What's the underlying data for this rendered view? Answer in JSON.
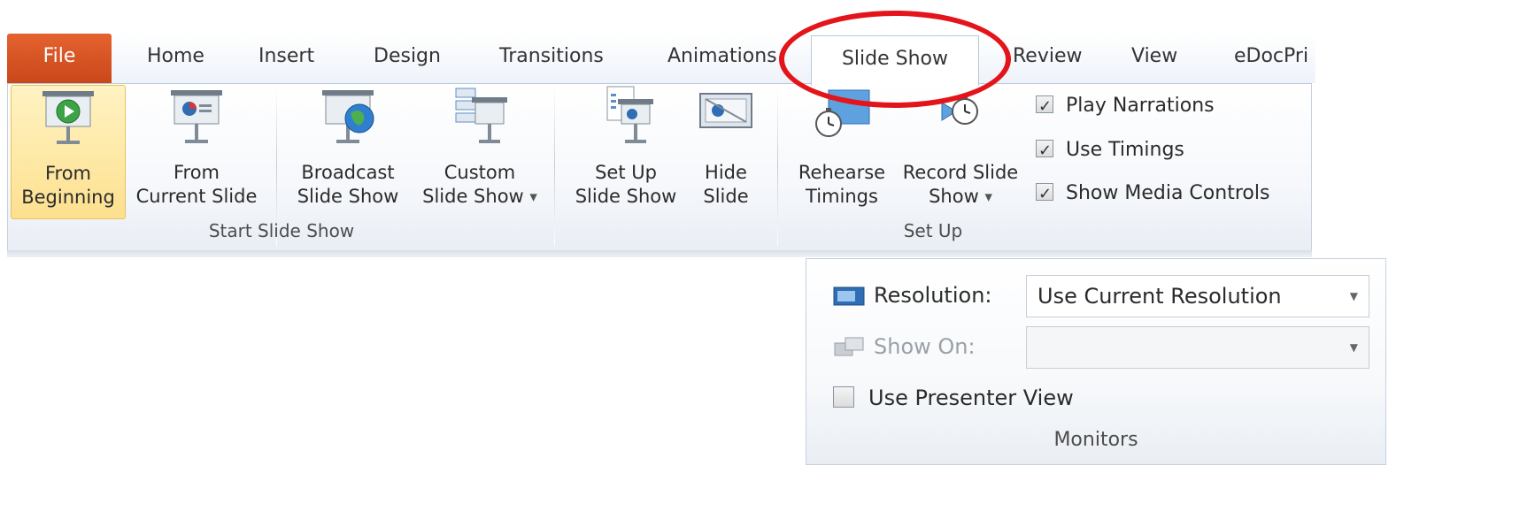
{
  "tabs": [
    {
      "label": "File"
    },
    {
      "label": "Home"
    },
    {
      "label": "Insert"
    },
    {
      "label": "Design"
    },
    {
      "label": "Transitions"
    },
    {
      "label": "Animations"
    },
    {
      "label": "Slide Show"
    },
    {
      "label": "Review"
    },
    {
      "label": "View"
    },
    {
      "label": "eDocPri"
    }
  ],
  "active_tab": "Slide Show",
  "groups": {
    "start": {
      "label": "Start Slide Show",
      "buttons": [
        {
          "line1": "From",
          "line2": "Beginning"
        },
        {
          "line1": "From",
          "line2": "Current Slide"
        },
        {
          "line1": "Broadcast",
          "line2": "Slide Show"
        },
        {
          "line1": "Custom",
          "line2": "Slide Show"
        }
      ]
    },
    "setup": {
      "label": "Set Up",
      "buttons": [
        {
          "line1": "Set Up",
          "line2": "Slide Show"
        },
        {
          "line1": "Hide",
          "line2": "Slide"
        },
        {
          "line1": "Rehearse",
          "line2": "Timings"
        },
        {
          "line1": "Record Slide",
          "line2": "Show"
        }
      ],
      "checkboxes": [
        {
          "label": "Play Narrations",
          "checked": true
        },
        {
          "label": "Use Timings",
          "checked": true
        },
        {
          "label": "Show Media Controls",
          "checked": true
        }
      ]
    },
    "monitors": {
      "label": "Monitors",
      "resolution_label": "Resolution:",
      "resolution_value": "Use Current Resolution",
      "show_on_label": "Show On:",
      "show_on_value": "",
      "presenter_view_label": "Use Presenter View",
      "presenter_view_checked": false
    }
  },
  "colors": {
    "file_tab": "#d2541f",
    "highlight": "#fde08f",
    "annotation_circle": "#e4141b"
  }
}
